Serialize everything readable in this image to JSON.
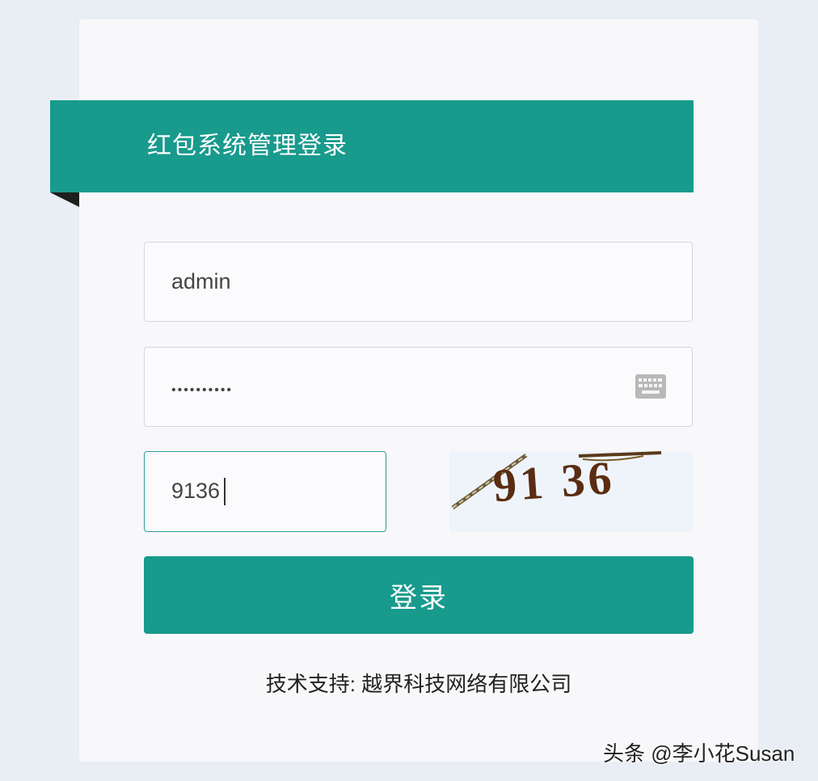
{
  "header": {
    "title": "红包系统管理登录"
  },
  "form": {
    "username_value": "admin",
    "password_value": "••••••••••",
    "captcha_input_value": "9136",
    "captcha_image_text": "91 36",
    "keyboard_icon": "keyboard-icon",
    "login_label": "登录"
  },
  "footer": {
    "support_text": "技术支持: 越界科技网络有限公司"
  },
  "watermark": {
    "text": "头条 @李小花Susan"
  },
  "colors": {
    "accent": "#189a8d",
    "background": "#e9eef5",
    "card": "#f8f8fb",
    "captcha_digits": "#5a2d12"
  }
}
